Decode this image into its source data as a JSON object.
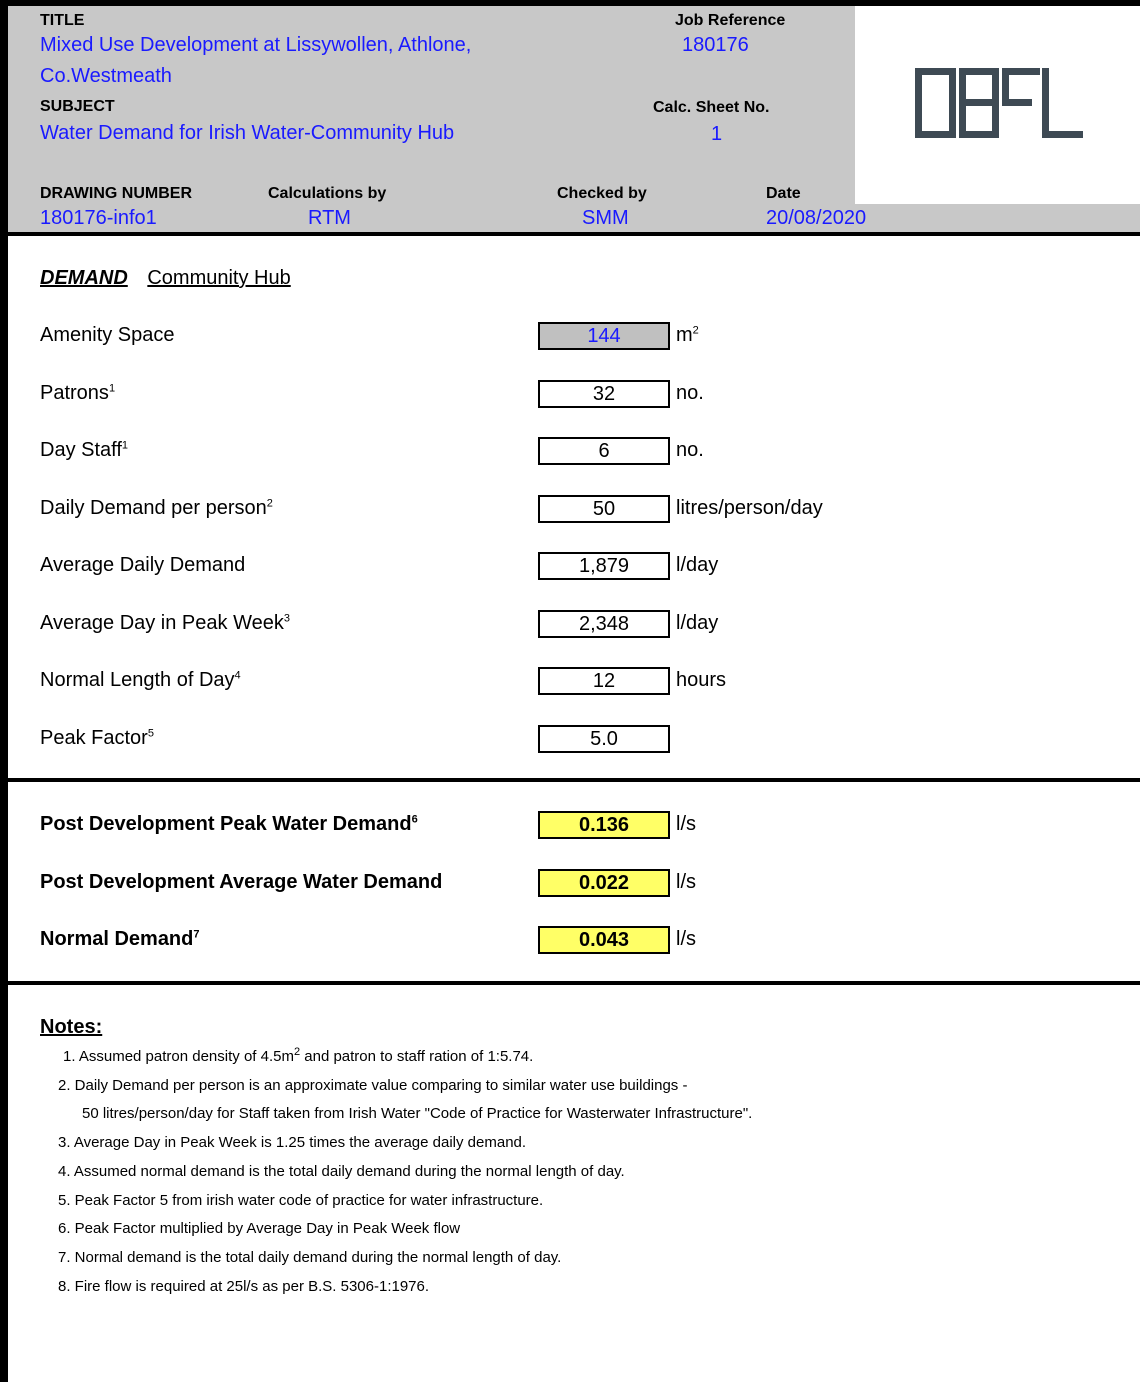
{
  "header": {
    "title_label": "TITLE",
    "title_line1": "Mixed Use Development at Lissywollen, Athlone,",
    "title_line2": "Co.Westmeath",
    "job_ref_label": "Job Reference",
    "job_ref": "180176",
    "subject_label": "SUBJECT",
    "subject": "Water Demand for Irish Water-Community Hub",
    "calc_sheet_label": "Calc. Sheet No.",
    "calc_sheet": "1",
    "drawing_label": "DRAWING NUMBER",
    "drawing": "180176-info1",
    "calc_by_label": "Calculations by",
    "calc_by": "RTM",
    "checked_label": "Checked by",
    "checked": "SMM",
    "date_label": "Date",
    "date": "20/08/2020",
    "logo_text": "DBFL",
    "logo_color": "#3e4a54"
  },
  "demand": {
    "heading": "DEMAND",
    "subheading": "Community Hub",
    "rows": [
      {
        "label": "Amenity Space",
        "sup": "",
        "value": "144",
        "unit": "m",
        "unit_sup": "2"
      },
      {
        "label": "Patrons",
        "sup": "1",
        "value": "32",
        "unit": "no.",
        "unit_sup": ""
      },
      {
        "label": "Day Staff",
        "sup": "1",
        "value": "6",
        "unit": "no.",
        "unit_sup": ""
      },
      {
        "label": "Daily Demand per person",
        "sup": "2",
        "value": "50",
        "unit": "litres/person/day",
        "unit_sup": ""
      },
      {
        "label": "Average Daily Demand",
        "sup": "",
        "value": "1,879",
        "unit": "l/day",
        "unit_sup": ""
      },
      {
        "label": "Average Day in Peak Week",
        "sup": "3",
        "value": "2,348",
        "unit": "l/day",
        "unit_sup": ""
      },
      {
        "label": "Normal Length of Day",
        "sup": "4",
        "value": "12",
        "unit": "hours",
        "unit_sup": ""
      },
      {
        "label": "Peak Factor",
        "sup": "5",
        "value": "5.0",
        "unit": "",
        "unit_sup": ""
      }
    ]
  },
  "results": [
    {
      "label": "Post Development Peak Water Demand",
      "sup": "6",
      "value": "0.136",
      "unit": "l/s"
    },
    {
      "label": "Post Development Average Water Demand",
      "sup": "",
      "value": "0.022",
      "unit": "l/s"
    },
    {
      "label": "Normal Demand",
      "sup": "7",
      "value": "0.043",
      "unit": "l/s"
    }
  ],
  "notes": {
    "heading": "Notes:",
    "n1_pre": "1. Assumed patron density of 4.5m",
    "n1_sup": "2",
    "n1_post": " and patron to staff ration of 1:5.74.",
    "n2a": "2. Daily Demand per person is an approximate value comparing to similar water use buildings -",
    "n2b": "50 litres/person/day for Staff taken from Irish Water \"Code of Practice for Wasterwater Infrastructure\".",
    "n3": "3. Average Day in Peak Week is 1.25 times the average daily demand.",
    "n4": "4. Assumed normal demand is the total daily demand during the normal length of day.",
    "n5": "5. Peak Factor 5 from irish water code of practice for water infrastructure.",
    "n6": "6. Peak Factor multiplied by Average Day in Peak Week flow",
    "n7": "7. Normal demand is the total daily demand during the normal length of day.",
    "n8": "8. Fire flow is required at 25l/s as per B.S. 5306-1:1976."
  },
  "colors": {
    "header_bg": "#c8c8c8",
    "input_blue": "#1a1aff",
    "highlight": "#ffff66"
  }
}
